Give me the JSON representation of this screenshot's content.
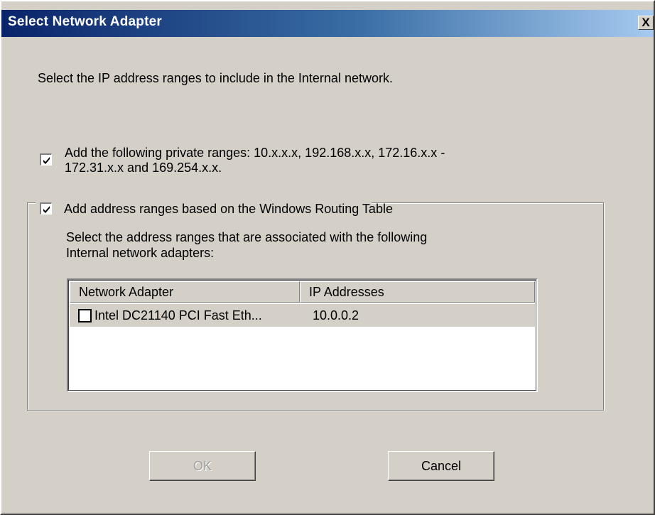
{
  "window": {
    "title": "Select Network Adapter",
    "close_label": "X"
  },
  "intro": "Select the IP address ranges to include in the Internal network.",
  "private_ranges": {
    "checked": true,
    "line1": "Add the following private ranges: 10.x.x.x, 192.168.x.x, 172.16.x.x -",
    "line2": "172.31.x.x and 169.254.x.x."
  },
  "routing_table": {
    "checked": true,
    "label": "Add address ranges based on the Windows Routing Table",
    "description_line1": "Select the address ranges that are associated with the following",
    "description_line2": "Internal network adapters:"
  },
  "adapter_list": {
    "columns": [
      "Network Adapter",
      "IP Addresses"
    ],
    "rows": [
      {
        "checked": false,
        "adapter": "Intel DC21140 PCI Fast Eth...",
        "ip": "10.0.0.2"
      }
    ]
  },
  "buttons": {
    "ok": "OK",
    "cancel": "Cancel"
  },
  "colors": {
    "title_gradient_start": "#0a246a",
    "title_gradient_end": "#a6caf0",
    "dialog_face": "#d4d0c8"
  }
}
